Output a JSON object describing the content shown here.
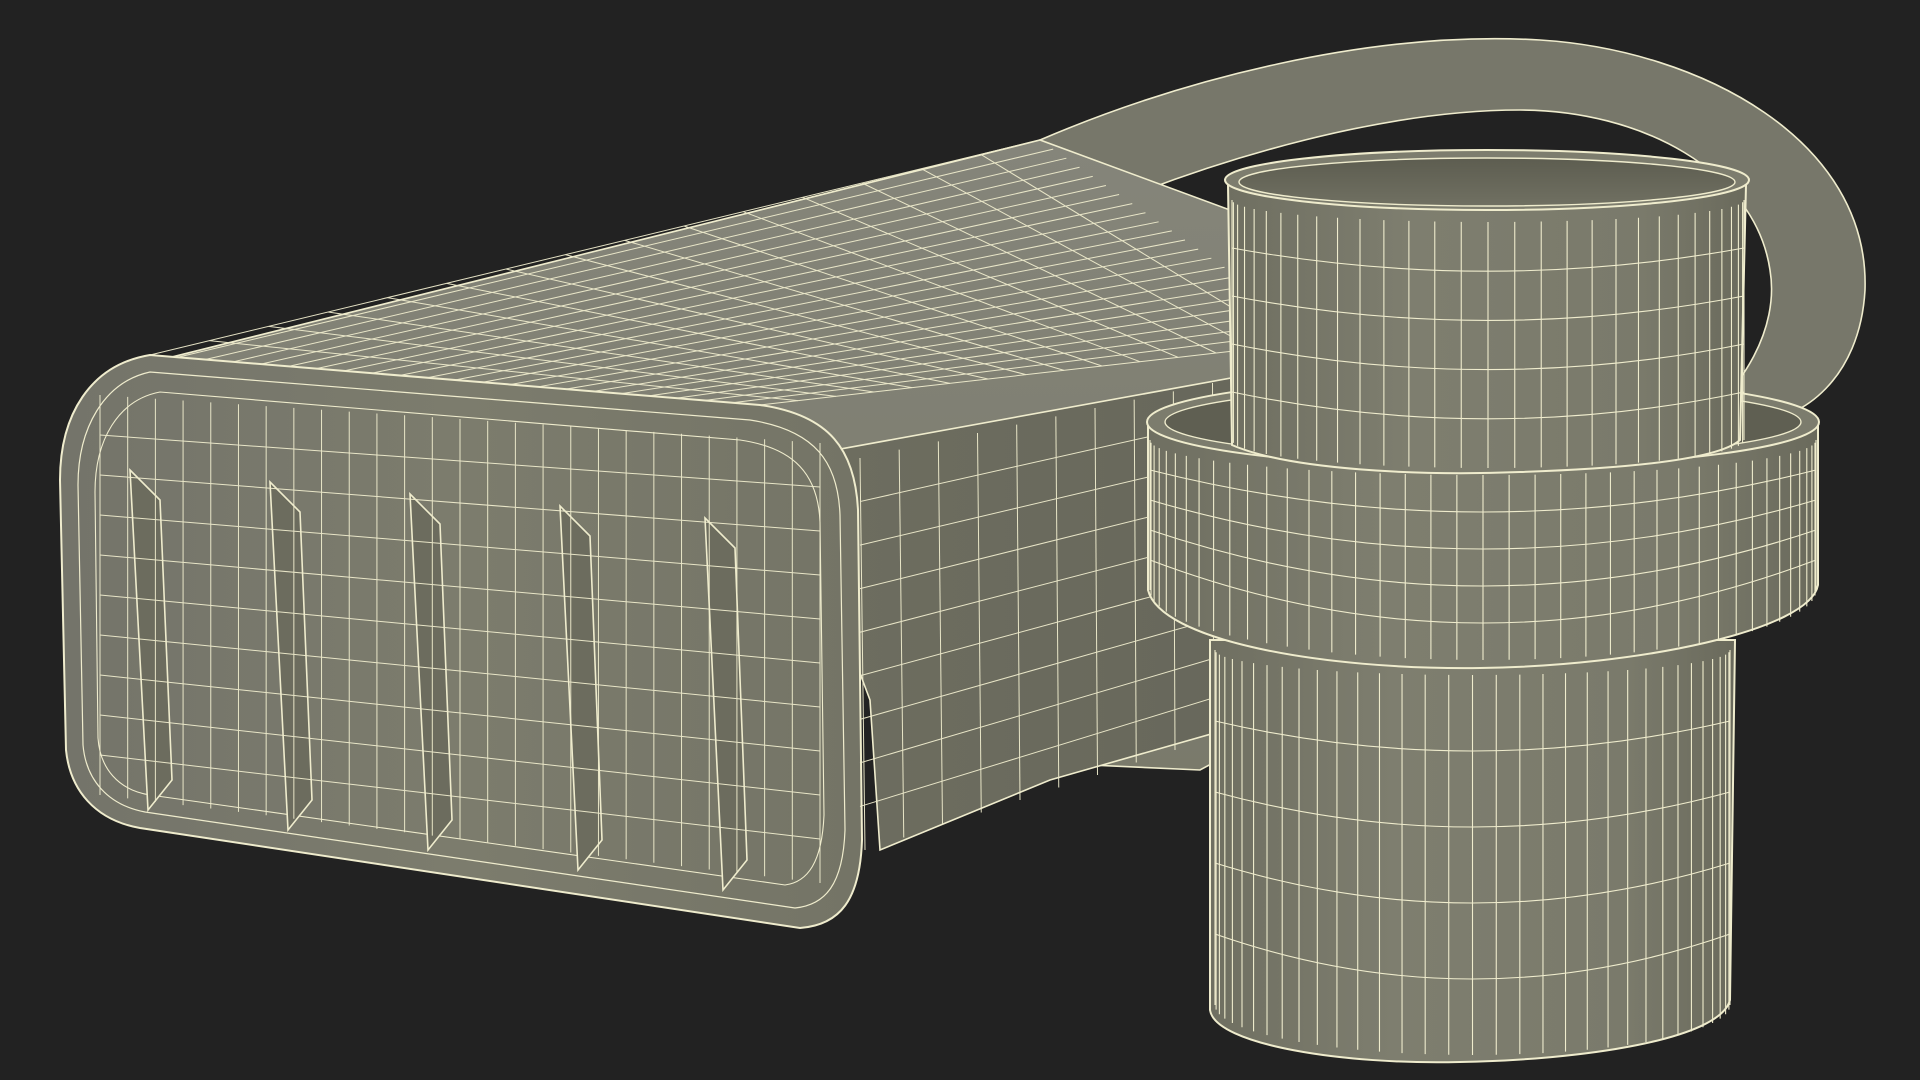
{
  "scene": {
    "background_color": "#222222",
    "surface_color": "#7b7b6a",
    "surface_shadow_color": "#6c6c5c",
    "surface_highlight_color": "#86867a",
    "wire_color": "#efeccd",
    "model": "wireframe-canister-with-cap"
  }
}
